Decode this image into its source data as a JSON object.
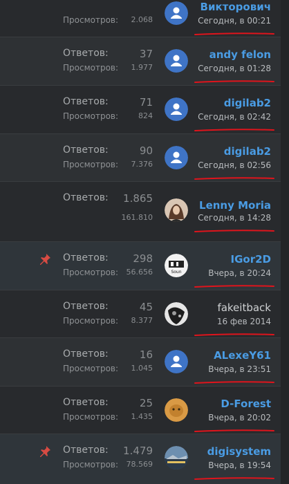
{
  "labels": {
    "replies": "Ответов:",
    "views": "Просмотров:"
  },
  "colors": {
    "accent_user": "#4a9ce4",
    "underline": "#e0141c",
    "default_avatar": "#3f74c6",
    "pin": "#d84b43"
  },
  "rows": [
    {
      "replies": "",
      "views": "2.068",
      "user": "Викторович",
      "date": "Сегодня, в 00:21",
      "avatar": "default-avatar-icon",
      "sticky": false,
      "user_style": "link"
    },
    {
      "replies": "37",
      "views": "1.977",
      "user": "andy felon",
      "date": "Сегодня, в 01:28",
      "avatar": "default-avatar-icon",
      "sticky": false,
      "user_style": "link"
    },
    {
      "replies": "71",
      "views": "824",
      "user": "digilab2",
      "date": "Сегодня, в 02:42",
      "avatar": "default-avatar-icon",
      "sticky": false,
      "user_style": "link"
    },
    {
      "replies": "90",
      "views": "7.376",
      "user": "digilab2",
      "date": "Сегодня, в 02:56",
      "avatar": "default-avatar-icon",
      "sticky": false,
      "user_style": "link"
    },
    {
      "replies": "1.865",
      "views": "161.810",
      "user": "Lenny Moria",
      "date": "Сегодня, в 14:28",
      "avatar": "portrait-avatar",
      "sticky": false,
      "user_style": "link"
    },
    {
      "replies": "298",
      "views": "56.656",
      "user": "IGor2D",
      "date": "Вчера, в 20:24",
      "avatar": "sound-logo-avatar",
      "sticky": true,
      "user_style": "link"
    },
    {
      "replies": "45",
      "views": "8.377",
      "user": "fakeitback",
      "date": "16 фев 2014",
      "avatar": "bw-photo-avatar",
      "sticky": false,
      "user_style": "plain"
    },
    {
      "replies": "16",
      "views": "1.045",
      "user": "ALexeY61",
      "date": "Вчера, в 23:51",
      "avatar": "default-avatar-icon",
      "sticky": false,
      "user_style": "link"
    },
    {
      "replies": "25",
      "views": "1.435",
      "user": "D-Forest",
      "date": "Вчера, в 20:02",
      "avatar": "cat-avatar",
      "sticky": false,
      "user_style": "link"
    },
    {
      "replies": "1.479",
      "views": "78.569",
      "user": "digisystem",
      "date": "Вчера, в 19:54",
      "avatar": "landscape-avatar",
      "sticky": true,
      "user_style": "link"
    }
  ]
}
